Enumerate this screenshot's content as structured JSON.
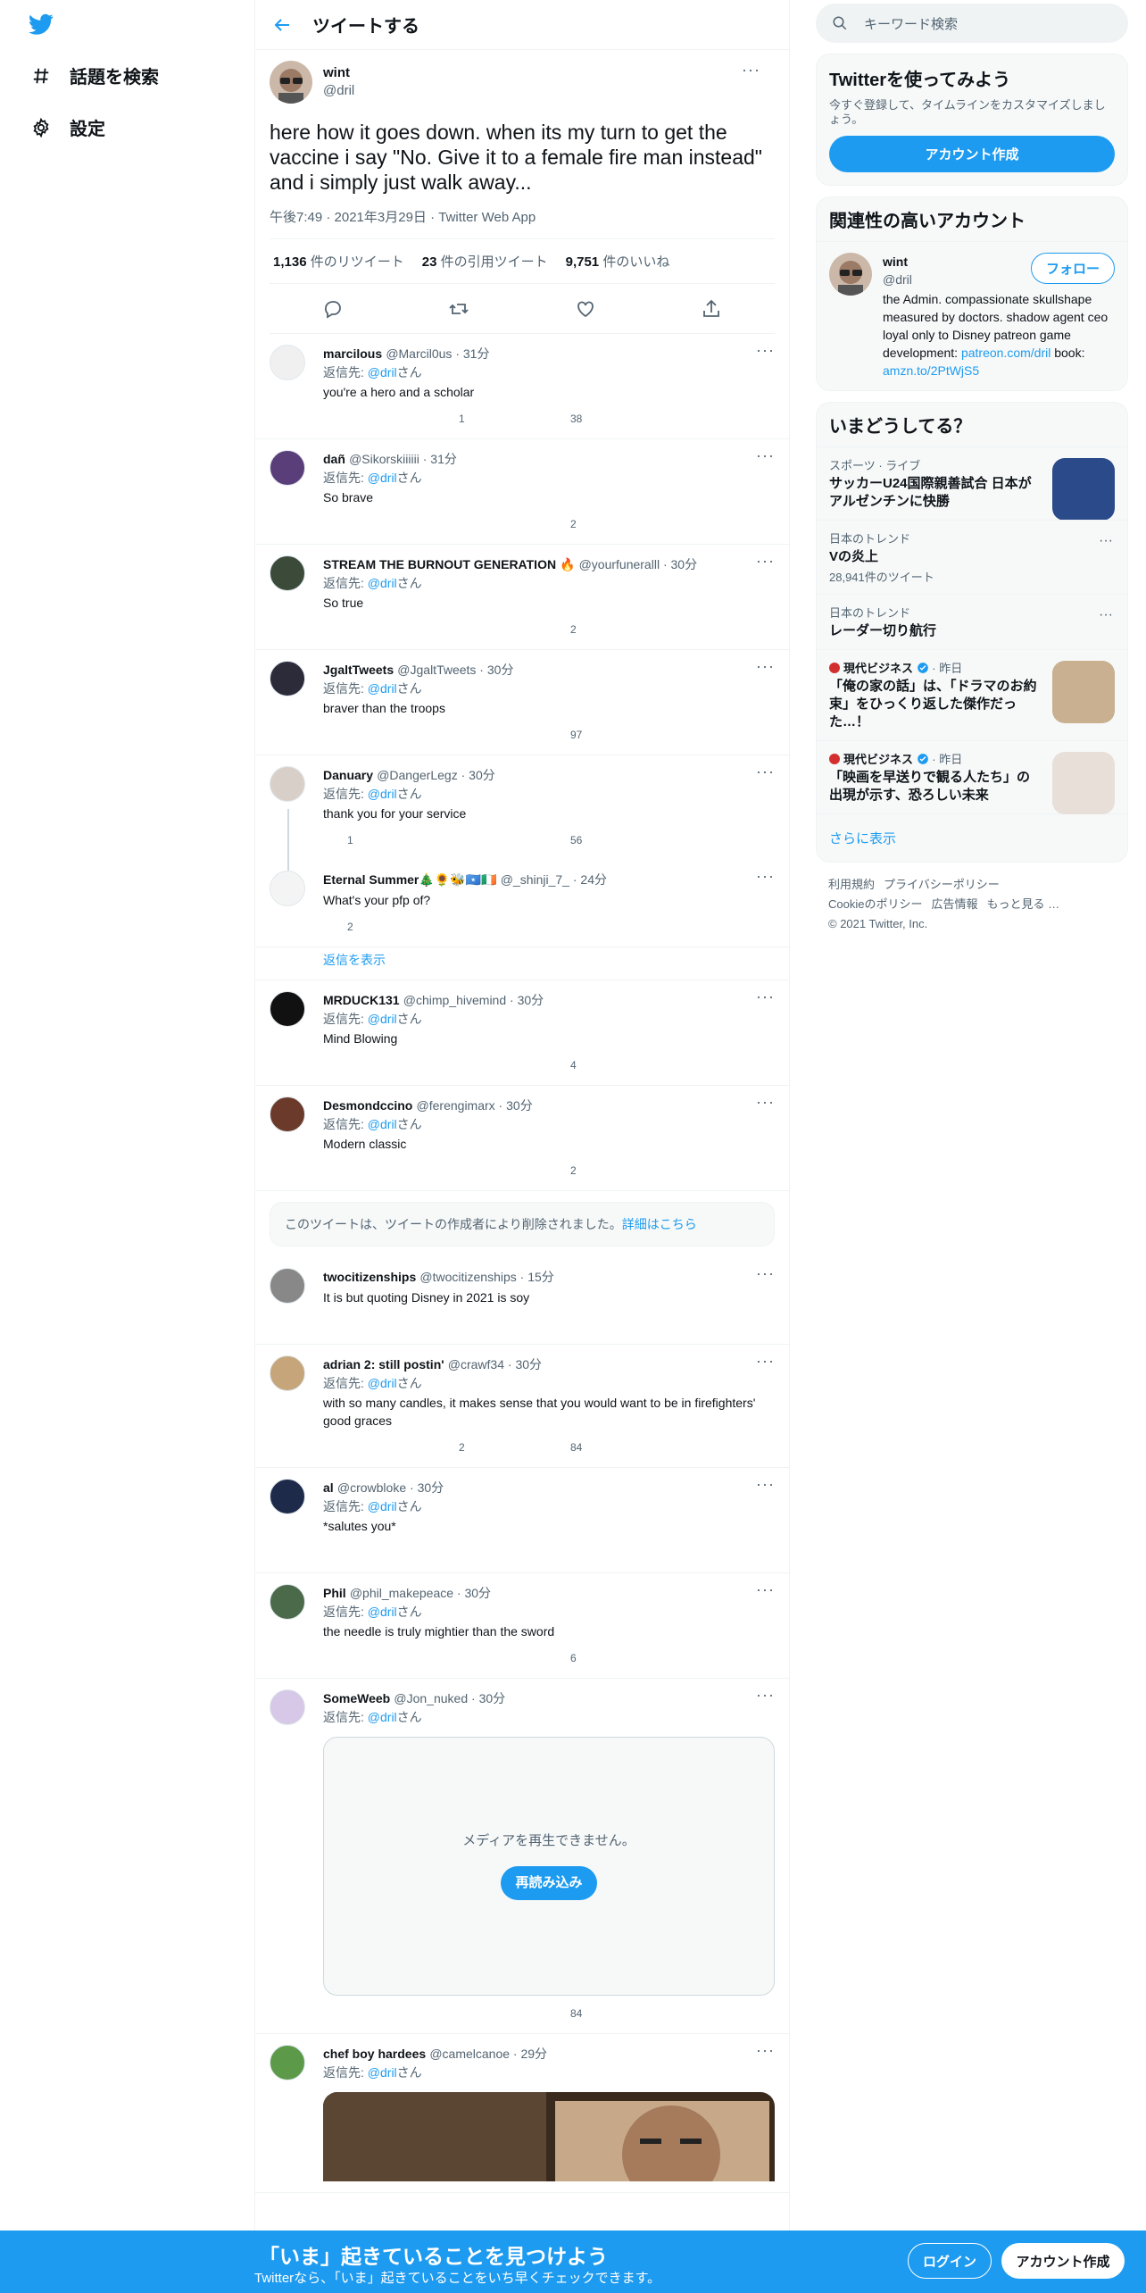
{
  "nav": {
    "items": [
      {
        "label": "話題を検索",
        "icon": "hashtag-icon"
      },
      {
        "label": "設定",
        "icon": "gear-icon"
      }
    ]
  },
  "header": {
    "title": "ツイートする"
  },
  "focal_tweet": {
    "name": "wint",
    "handle": "@dril",
    "text": "here how it goes down. when its my turn to get the vaccine i say \"No. Give it to a female fire man instead\" and i simply just walk away...",
    "meta": "午後7:49 · 2021年3月29日 · Twitter Web App",
    "stats": [
      {
        "value": "1,136",
        "label": "件のリツイート"
      },
      {
        "value": "23",
        "label": "件の引用ツイート"
      },
      {
        "value": "9,751",
        "label": "件のいいね"
      }
    ]
  },
  "replying_label": "返信先: ",
  "replying_to": "@dril",
  "replying_suffix": "さん",
  "show_replies": "返信を表示",
  "deleted_notice": {
    "text": "このツイートは、ツイートの作成者により削除されました。",
    "link": "詳細はこちら"
  },
  "replies": [
    {
      "name": "marcilous",
      "handle": "@Marcil0us",
      "time": "31分",
      "text": "you're a hero and a scholar",
      "rt": "1",
      "likes": "38",
      "replies": ""
    },
    {
      "name": "dañ",
      "handle": "@Sikorskiiiiii",
      "time": "31分",
      "text": "So brave",
      "rt": "",
      "likes": "2",
      "replies": ""
    },
    {
      "name": "STREAM THE BURNOUT GENERATION 🔥",
      "handle": "@yourfuneralll",
      "time": "30分",
      "text": "So true",
      "rt": "",
      "likes": "2",
      "replies": ""
    },
    {
      "name": "JgaltTweets",
      "handle": "@JgaltTweets",
      "time": "30分",
      "text": "braver than the troops",
      "rt": "",
      "likes": "97",
      "replies": ""
    },
    {
      "name": "Danuary",
      "handle": "@DangerLegz",
      "time": "30分",
      "text": "thank you for your service",
      "rt": "",
      "likes": "56",
      "replies": "1"
    },
    {
      "name": "Eternal Summer🎄🌻🐝🇸🇴🇮🇪",
      "handle": "@_shinji_7_",
      "time": "24分",
      "text": "What's your pfp of?",
      "rt": "",
      "likes": "",
      "replies": "2"
    },
    {
      "name": "MRDUCK131",
      "handle": "@chimp_hivemind",
      "time": "30分",
      "text": "Mind Blowing",
      "rt": "",
      "likes": "4",
      "replies": ""
    },
    {
      "name": "Desmondccino",
      "handle": "@ferengimarx",
      "time": "30分",
      "text": "Modern classic",
      "rt": "",
      "likes": "2",
      "replies": ""
    },
    {
      "name": "twocitizenships",
      "handle": "@twocitizenships",
      "time": "15分",
      "text": "It is but quoting Disney in 2021 is soy",
      "rt": "",
      "likes": "",
      "replies": ""
    },
    {
      "name": "adrian 2: still postin'",
      "handle": "@crawf34",
      "time": "30分",
      "text": "with so many candles, it makes sense that you would want to be in firefighters' good graces",
      "rt": "2",
      "likes": "84",
      "replies": ""
    },
    {
      "name": "al",
      "handle": "@crowbloke",
      "time": "30分",
      "text": "*salutes you*",
      "rt": "",
      "likes": "",
      "replies": ""
    },
    {
      "name": "Phil",
      "handle": "@phil_makepeace",
      "time": "30分",
      "text": "the needle is truly mightier than the sword",
      "rt": "",
      "likes": "6",
      "replies": ""
    },
    {
      "name": "SomeWeeb",
      "handle": "@Jon_nuked",
      "time": "30分",
      "text": "",
      "rt": "",
      "likes": "84",
      "replies": ""
    },
    {
      "name": "chef boy hardees",
      "handle": "@camelcanoe",
      "time": "29分",
      "text": "",
      "rt": "",
      "likes": "",
      "replies": ""
    }
  ],
  "media_error": {
    "text": "メディアを再生できません。",
    "button": "再読み込み"
  },
  "right": {
    "search_placeholder": "キーワード検索",
    "signup": {
      "title": "Twitterを使ってみよう",
      "desc": "今すぐ登録して、タイムラインをカスタマイズしましょう。",
      "button": "アカウント作成"
    },
    "related": {
      "title": "関連性の高いアカウント",
      "name": "wint",
      "handle": "@dril",
      "follow": "フォロー",
      "bio": "the Admin. compassionate skullshape measured by doctors. shadow agent ceo loyal only to Disney patreon game development: ",
      "link1": "patreon.com/dril",
      "bio2": " book: ",
      "link2": "amzn.to/2PtWjS5"
    },
    "trends": {
      "title": "いまどうしてる？",
      "items": [
        {
          "category": "スポーツ · ライブ",
          "title": "サッカーU24国際親善試合 日本がアルゼンチンに快勝",
          "count": "",
          "thumb": true
        },
        {
          "category": "日本のトレンド",
          "title": "Vの炎上",
          "count": "28,941件のツイート",
          "thumb": false
        },
        {
          "category": "日本のトレンド",
          "title": "レーダー切り航行",
          "count": "",
          "thumb": false
        },
        {
          "category": "現代ビジネス",
          "time": "昨日",
          "title": "「俺の家の話」は、「ドラマのお約束」をひっくり返した傑作だった…！",
          "count": "",
          "thumb": true
        },
        {
          "category": "現代ビジネス",
          "time": "昨日",
          "title": "「映画を早送りで観る人たち」の出現が示す、恐ろしい未来",
          "count": "",
          "thumb": true
        }
      ],
      "show_more": "さらに表示"
    },
    "footer": {
      "links": [
        "利用規約",
        "プライバシーポリシー",
        "Cookieのポリシー",
        "広告情報",
        "もっと見る …"
      ],
      "copyright": "© 2021 Twitter, Inc."
    }
  },
  "bottom_bar": {
    "title": "「いま」起きていることを見つけよう",
    "subtitle": "Twitterなら、「いま」起きていることをいち早くチェックできます。",
    "login": "ログイン",
    "signup": "アカウント作成"
  },
  "colors": {
    "accent": "#1d9bf0",
    "text": "#0f1419",
    "muted": "#536471",
    "border": "#eff3f4"
  }
}
